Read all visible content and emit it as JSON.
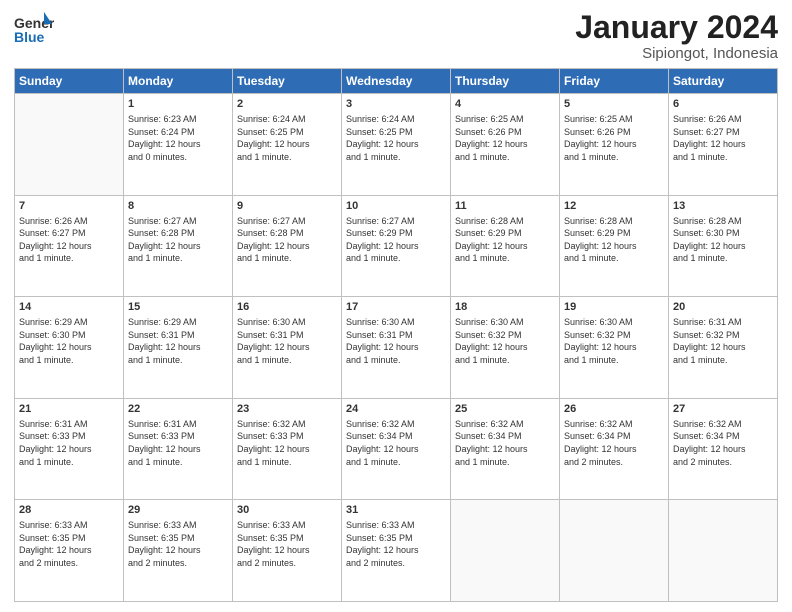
{
  "logo": {
    "general": "General",
    "blue": "Blue"
  },
  "header": {
    "month": "January 2024",
    "location": "Sipiongot, Indonesia"
  },
  "days_of_week": [
    "Sunday",
    "Monday",
    "Tuesday",
    "Wednesday",
    "Thursday",
    "Friday",
    "Saturday"
  ],
  "weeks": [
    [
      {
        "day": "",
        "info": ""
      },
      {
        "day": "1",
        "info": "Sunrise: 6:23 AM\nSunset: 6:24 PM\nDaylight: 12 hours\nand 0 minutes."
      },
      {
        "day": "2",
        "info": "Sunrise: 6:24 AM\nSunset: 6:25 PM\nDaylight: 12 hours\nand 1 minute."
      },
      {
        "day": "3",
        "info": "Sunrise: 6:24 AM\nSunset: 6:25 PM\nDaylight: 12 hours\nand 1 minute."
      },
      {
        "day": "4",
        "info": "Sunrise: 6:25 AM\nSunset: 6:26 PM\nDaylight: 12 hours\nand 1 minute."
      },
      {
        "day": "5",
        "info": "Sunrise: 6:25 AM\nSunset: 6:26 PM\nDaylight: 12 hours\nand 1 minute."
      },
      {
        "day": "6",
        "info": "Sunrise: 6:26 AM\nSunset: 6:27 PM\nDaylight: 12 hours\nand 1 minute."
      }
    ],
    [
      {
        "day": "7",
        "info": "Sunrise: 6:26 AM\nSunset: 6:27 PM\nDaylight: 12 hours\nand 1 minute."
      },
      {
        "day": "8",
        "info": "Sunrise: 6:27 AM\nSunset: 6:28 PM\nDaylight: 12 hours\nand 1 minute."
      },
      {
        "day": "9",
        "info": "Sunrise: 6:27 AM\nSunset: 6:28 PM\nDaylight: 12 hours\nand 1 minute."
      },
      {
        "day": "10",
        "info": "Sunrise: 6:27 AM\nSunset: 6:29 PM\nDaylight: 12 hours\nand 1 minute."
      },
      {
        "day": "11",
        "info": "Sunrise: 6:28 AM\nSunset: 6:29 PM\nDaylight: 12 hours\nand 1 minute."
      },
      {
        "day": "12",
        "info": "Sunrise: 6:28 AM\nSunset: 6:29 PM\nDaylight: 12 hours\nand 1 minute."
      },
      {
        "day": "13",
        "info": "Sunrise: 6:28 AM\nSunset: 6:30 PM\nDaylight: 12 hours\nand 1 minute."
      }
    ],
    [
      {
        "day": "14",
        "info": "Sunrise: 6:29 AM\nSunset: 6:30 PM\nDaylight: 12 hours\nand 1 minute."
      },
      {
        "day": "15",
        "info": "Sunrise: 6:29 AM\nSunset: 6:31 PM\nDaylight: 12 hours\nand 1 minute."
      },
      {
        "day": "16",
        "info": "Sunrise: 6:30 AM\nSunset: 6:31 PM\nDaylight: 12 hours\nand 1 minute."
      },
      {
        "day": "17",
        "info": "Sunrise: 6:30 AM\nSunset: 6:31 PM\nDaylight: 12 hours\nand 1 minute."
      },
      {
        "day": "18",
        "info": "Sunrise: 6:30 AM\nSunset: 6:32 PM\nDaylight: 12 hours\nand 1 minute."
      },
      {
        "day": "19",
        "info": "Sunrise: 6:30 AM\nSunset: 6:32 PM\nDaylight: 12 hours\nand 1 minute."
      },
      {
        "day": "20",
        "info": "Sunrise: 6:31 AM\nSunset: 6:32 PM\nDaylight: 12 hours\nand 1 minute."
      }
    ],
    [
      {
        "day": "21",
        "info": "Sunrise: 6:31 AM\nSunset: 6:33 PM\nDaylight: 12 hours\nand 1 minute."
      },
      {
        "day": "22",
        "info": "Sunrise: 6:31 AM\nSunset: 6:33 PM\nDaylight: 12 hours\nand 1 minute."
      },
      {
        "day": "23",
        "info": "Sunrise: 6:32 AM\nSunset: 6:33 PM\nDaylight: 12 hours\nand 1 minute."
      },
      {
        "day": "24",
        "info": "Sunrise: 6:32 AM\nSunset: 6:34 PM\nDaylight: 12 hours\nand 1 minute."
      },
      {
        "day": "25",
        "info": "Sunrise: 6:32 AM\nSunset: 6:34 PM\nDaylight: 12 hours\nand 1 minute."
      },
      {
        "day": "26",
        "info": "Sunrise: 6:32 AM\nSunset: 6:34 PM\nDaylight: 12 hours\nand 2 minutes."
      },
      {
        "day": "27",
        "info": "Sunrise: 6:32 AM\nSunset: 6:34 PM\nDaylight: 12 hours\nand 2 minutes."
      }
    ],
    [
      {
        "day": "28",
        "info": "Sunrise: 6:33 AM\nSunset: 6:35 PM\nDaylight: 12 hours\nand 2 minutes."
      },
      {
        "day": "29",
        "info": "Sunrise: 6:33 AM\nSunset: 6:35 PM\nDaylight: 12 hours\nand 2 minutes."
      },
      {
        "day": "30",
        "info": "Sunrise: 6:33 AM\nSunset: 6:35 PM\nDaylight: 12 hours\nand 2 minutes."
      },
      {
        "day": "31",
        "info": "Sunrise: 6:33 AM\nSunset: 6:35 PM\nDaylight: 12 hours\nand 2 minutes."
      },
      {
        "day": "",
        "info": ""
      },
      {
        "day": "",
        "info": ""
      },
      {
        "day": "",
        "info": ""
      }
    ]
  ]
}
